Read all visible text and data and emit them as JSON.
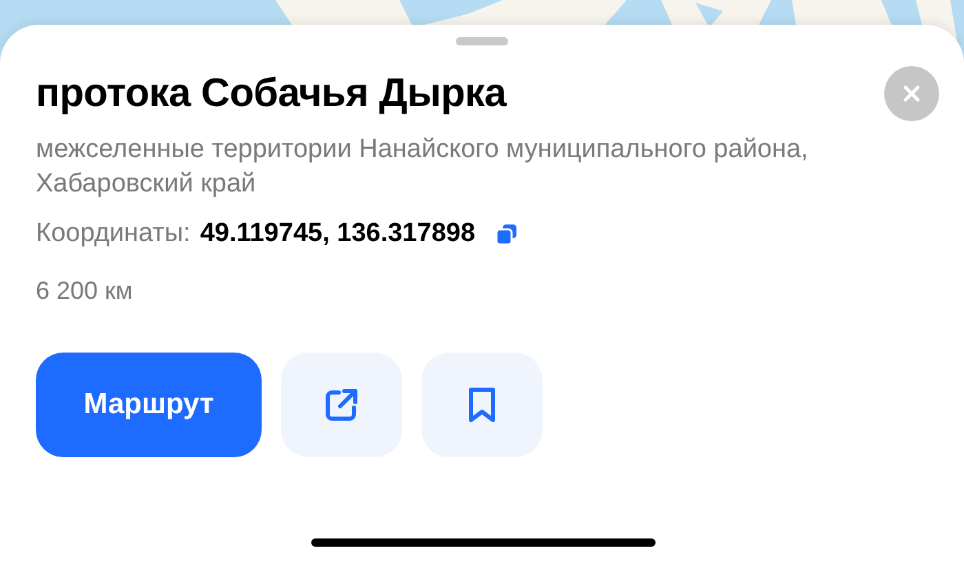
{
  "sheet": {
    "title": "протока Собачья Дырка",
    "address": "межселенные территории Нанайского муниципального района, Хабаровский край",
    "coordinates_label": "Координаты:",
    "coordinates_value": "49.119745, 136.317898",
    "distance": "6 200 км",
    "route_button": "Маршрут"
  }
}
